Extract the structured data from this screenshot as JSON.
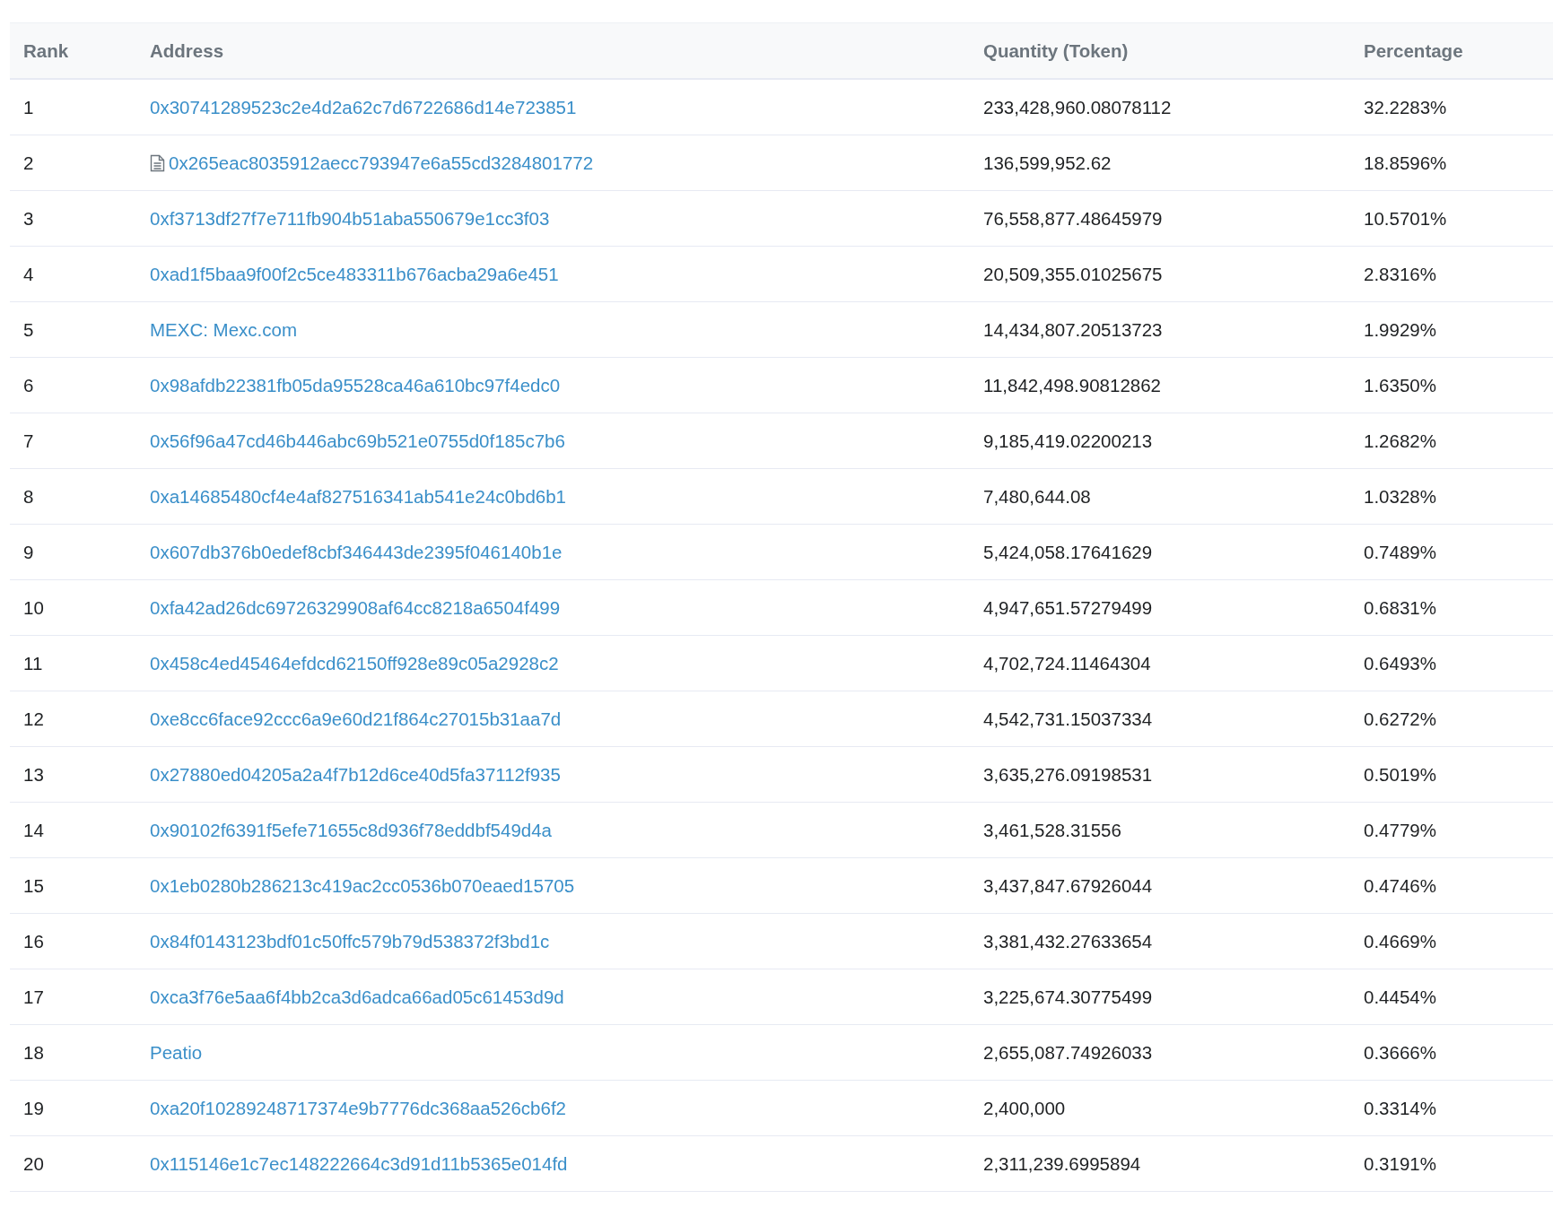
{
  "table": {
    "columns": [
      "Rank",
      "Address",
      "Quantity (Token)",
      "Percentage"
    ],
    "rows": [
      {
        "rank": "1",
        "address": "0x30741289523c2e4d2a62c7d6722686d14e723851",
        "contract": false,
        "quantity": "233,428,960.08078112",
        "percentage": "32.2283%"
      },
      {
        "rank": "2",
        "address": "0x265eac8035912aecc793947e6a55cd3284801772",
        "contract": true,
        "quantity": "136,599,952.62",
        "percentage": "18.8596%"
      },
      {
        "rank": "3",
        "address": "0xf3713df27f7e711fb904b51aba550679e1cc3f03",
        "contract": false,
        "quantity": "76,558,877.48645979",
        "percentage": "10.5701%"
      },
      {
        "rank": "4",
        "address": "0xad1f5baa9f00f2c5ce483311b676acba29a6e451",
        "contract": false,
        "quantity": "20,509,355.01025675",
        "percentage": "2.8316%"
      },
      {
        "rank": "5",
        "address": "MEXC: Mexc.com",
        "contract": false,
        "quantity": "14,434,807.20513723",
        "percentage": "1.9929%"
      },
      {
        "rank": "6",
        "address": "0x98afdb22381fb05da95528ca46a610bc97f4edc0",
        "contract": false,
        "quantity": "11,842,498.90812862",
        "percentage": "1.6350%"
      },
      {
        "rank": "7",
        "address": "0x56f96a47cd46b446abc69b521e0755d0f185c7b6",
        "contract": false,
        "quantity": "9,185,419.02200213",
        "percentage": "1.2682%"
      },
      {
        "rank": "8",
        "address": "0xa14685480cf4e4af827516341ab541e24c0bd6b1",
        "contract": false,
        "quantity": "7,480,644.08",
        "percentage": "1.0328%"
      },
      {
        "rank": "9",
        "address": "0x607db376b0edef8cbf346443de2395f046140b1e",
        "contract": false,
        "quantity": "5,424,058.17641629",
        "percentage": "0.7489%"
      },
      {
        "rank": "10",
        "address": "0xfa42ad26dc69726329908af64cc8218a6504f499",
        "contract": false,
        "quantity": "4,947,651.57279499",
        "percentage": "0.6831%"
      },
      {
        "rank": "11",
        "address": "0x458c4ed45464efdcd62150ff928e89c05a2928c2",
        "contract": false,
        "quantity": "4,702,724.11464304",
        "percentage": "0.6493%"
      },
      {
        "rank": "12",
        "address": "0xe8cc6face92ccc6a9e60d21f864c27015b31aa7d",
        "contract": false,
        "quantity": "4,542,731.15037334",
        "percentage": "0.6272%"
      },
      {
        "rank": "13",
        "address": "0x27880ed04205a2a4f7b12d6ce40d5fa37112f935",
        "contract": false,
        "quantity": "3,635,276.09198531",
        "percentage": "0.5019%"
      },
      {
        "rank": "14",
        "address": "0x90102f6391f5efe71655c8d936f78eddbf549d4a",
        "contract": false,
        "quantity": "3,461,528.31556",
        "percentage": "0.4779%"
      },
      {
        "rank": "15",
        "address": "0x1eb0280b286213c419ac2cc0536b070eaed15705",
        "contract": false,
        "quantity": "3,437,847.67926044",
        "percentage": "0.4746%"
      },
      {
        "rank": "16",
        "address": "0x84f0143123bdf01c50ffc579b79d538372f3bd1c",
        "contract": false,
        "quantity": "3,381,432.27633654",
        "percentage": "0.4669%"
      },
      {
        "rank": "17",
        "address": "0xca3f76e5aa6f4bb2ca3d6adca66ad05c61453d9d",
        "contract": false,
        "quantity": "3,225,674.30775499",
        "percentage": "0.4454%"
      },
      {
        "rank": "18",
        "address": "Peatio",
        "contract": false,
        "quantity": "2,655,087.74926033",
        "percentage": "0.3666%"
      },
      {
        "rank": "19",
        "address": "0xa20f10289248717374e9b7776dc368aa526cb6f2",
        "contract": false,
        "quantity": "2,400,000",
        "percentage": "0.3314%"
      },
      {
        "rank": "20",
        "address": "0x115146e1c7ec148222664c3d91d11b5365e014fd",
        "contract": false,
        "quantity": "2,311,239.6995894",
        "percentage": "0.3191%"
      }
    ]
  }
}
